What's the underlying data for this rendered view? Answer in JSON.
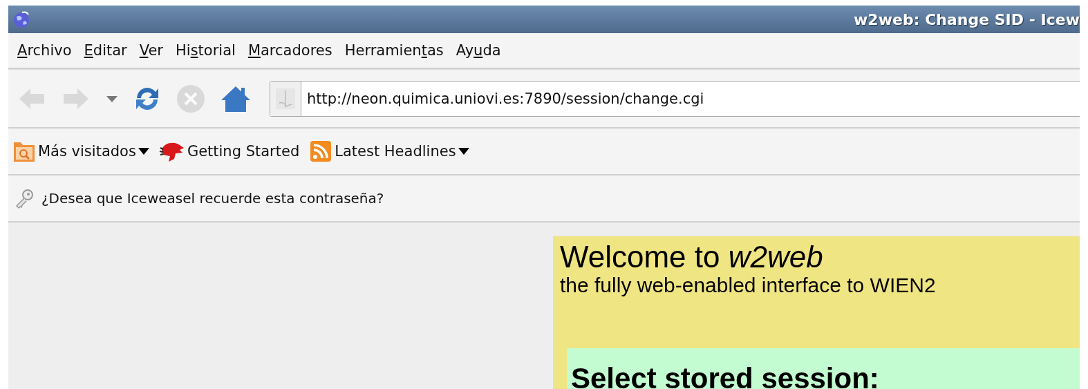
{
  "window": {
    "title": "w2web: Change SID - Icew"
  },
  "menu": [
    {
      "key": "A",
      "post": "rchivo"
    },
    {
      "key": "E",
      "post": "ditar"
    },
    {
      "key": "V",
      "post": "er"
    },
    {
      "pre": "Hi",
      "key": "s",
      "post": "torial"
    },
    {
      "key": "M",
      "post": "arcadores"
    },
    {
      "pre": "Herramien",
      "key": "t",
      "post": "as"
    },
    {
      "pre": "Ay",
      "key": "u",
      "post": "da"
    }
  ],
  "toolbar": [
    {
      "kind": "back",
      "disabled": true
    },
    {
      "kind": "forward",
      "disabled": true
    },
    {
      "kind": "history",
      "disabled": false
    },
    {
      "kind": "reload",
      "disabled": false
    },
    {
      "kind": "stop",
      "disabled": true
    },
    {
      "kind": "home",
      "disabled": false
    }
  ],
  "address_bar": {
    "value": "http://neon.quimica.uniovi.es:7890/session/change.cgi"
  },
  "bookmarks": [
    {
      "kind": "folder",
      "label": "Más visitados",
      "dropdown": true
    },
    {
      "kind": "site",
      "label": "Getting Started",
      "dropdown": false
    },
    {
      "kind": "feed",
      "label": "Latest Headlines",
      "dropdown": true
    }
  ],
  "notification": {
    "text": "¿Desea que Iceweasel recuerde esta contraseña?"
  },
  "page": {
    "heading": "Welcome to *w2web*",
    "subtitle": "the fully web-enabled interface to WIEN2",
    "section_heading": "Select stored session:"
  }
}
